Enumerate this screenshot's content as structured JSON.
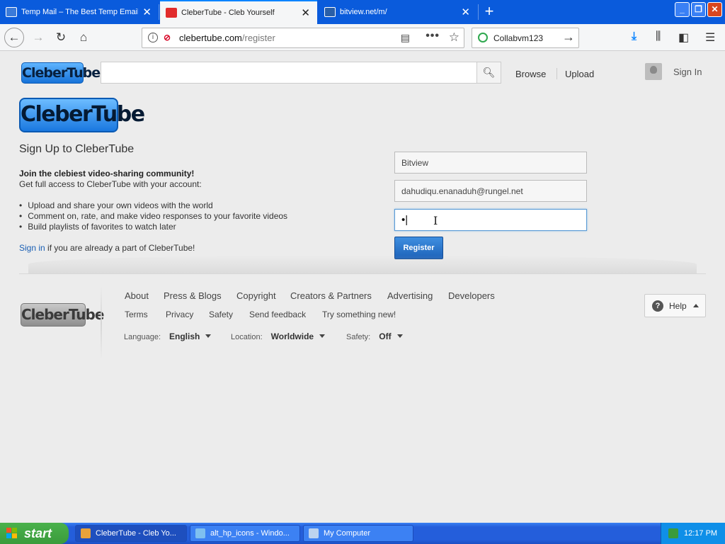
{
  "browser": {
    "tabs": [
      {
        "title": "Temp Mail – The Best Temp Email S",
        "active": false
      },
      {
        "title": "CleberTube - Cleb Yourself",
        "active": true
      },
      {
        "title": "bitview.net/m/",
        "active": false
      }
    ],
    "url_domain": "clebertube.com",
    "url_path": "/register",
    "search_engine_text": "Collabvm123"
  },
  "header": {
    "logo_text": "CleberTube",
    "search_value": "",
    "browse": "Browse",
    "upload": "Upload",
    "sign_in": "Sign In"
  },
  "signup": {
    "title": "Sign Up to CleberTube",
    "intro_bold": "Join the clebiest video-sharing community!",
    "intro": "Get full access to CleberTube with your account:",
    "bullets": [
      "Upload and share your own videos with the world",
      "Comment on, rate, and make video responses to your favorite videos",
      "Build playlists of favorites to watch later"
    ],
    "signin_link": "Sign in",
    "signin_rest": " if you are already a part of CleberTube!",
    "username_value": "Bitview",
    "email_value": "dahudiqu.enanaduh@rungel.net",
    "password_value": "•|",
    "register_label": "Register"
  },
  "footer": {
    "links1": [
      "About",
      "Press & Blogs",
      "Copyright",
      "Creators & Partners",
      "Advertising",
      "Developers"
    ],
    "links2": [
      "Terms",
      "Privacy",
      "Safety",
      "Send feedback",
      "Try something new!"
    ],
    "language_label": "Language:",
    "language_value": "English",
    "location_label": "Location:",
    "location_value": "Worldwide",
    "safety_label": "Safety:",
    "safety_value": "Off",
    "help_label": "Help"
  },
  "taskbar": {
    "start_label": "start",
    "tasks": [
      {
        "label": "CleberTube - Cleb Yo...",
        "active": true
      },
      {
        "label": "alt_hp_icons - Windo...",
        "active": false
      },
      {
        "label": "My Computer",
        "active": false
      }
    ],
    "clock": "12:17 PM"
  },
  "colors": {
    "tabbar": "#0a5bdc",
    "accent_blue": "#1d62b9",
    "link": "#1a5fb4",
    "taskbar": "#245edb",
    "start_green": "#3a9b3c"
  }
}
